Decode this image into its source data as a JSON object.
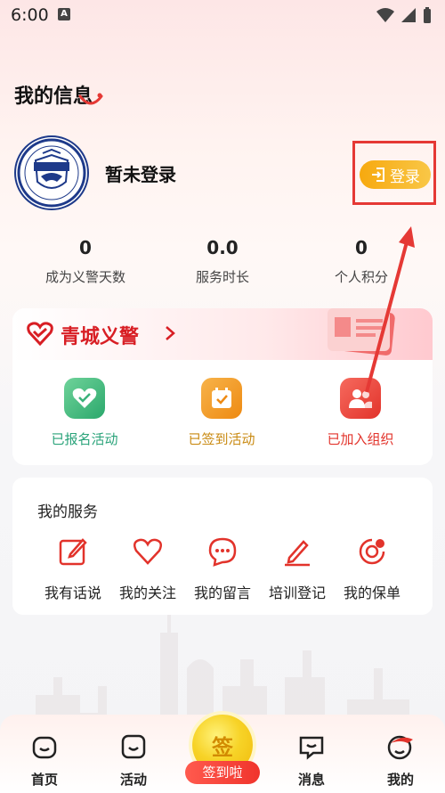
{
  "status_bar": {
    "time": "6:00",
    "notif_icon": "A"
  },
  "page": {
    "title": "我的信息"
  },
  "profile": {
    "username": "暂未登录",
    "login_label": "登录"
  },
  "stats": [
    {
      "value": "0",
      "label": "成为义警天数"
    },
    {
      "value": "0.0",
      "label": "服务时长"
    },
    {
      "value": "0",
      "label": "个人积分"
    }
  ],
  "org": {
    "title": "青城义警",
    "actions": [
      {
        "label": "已报名活动",
        "color": "#2aa37a"
      },
      {
        "label": "已签到活动",
        "color": "#c98a12"
      },
      {
        "label": "已加入组织",
        "color": "#e2332b"
      }
    ]
  },
  "services": {
    "title": "我的服务",
    "items": [
      {
        "label": "我有话说",
        "icon": "edit-icon"
      },
      {
        "label": "我的关注",
        "icon": "heart-icon"
      },
      {
        "label": "我的留言",
        "icon": "message-icon"
      },
      {
        "label": "培训登记",
        "icon": "pen-icon"
      },
      {
        "label": "我的保单",
        "icon": "policy-icon"
      }
    ]
  },
  "bottom_nav": {
    "items": [
      {
        "label": "首页",
        "icon": "home-icon"
      },
      {
        "label": "活动",
        "icon": "activity-icon"
      },
      {
        "label": "消息",
        "icon": "message-icon"
      },
      {
        "label": "我的",
        "icon": "profile-icon"
      }
    ],
    "signin_char": "签",
    "signin_label": "签到啦"
  },
  "colors": {
    "accent_red": "#e53935",
    "login_orange": "#f7a90f",
    "brand_red": "#d81e24"
  }
}
